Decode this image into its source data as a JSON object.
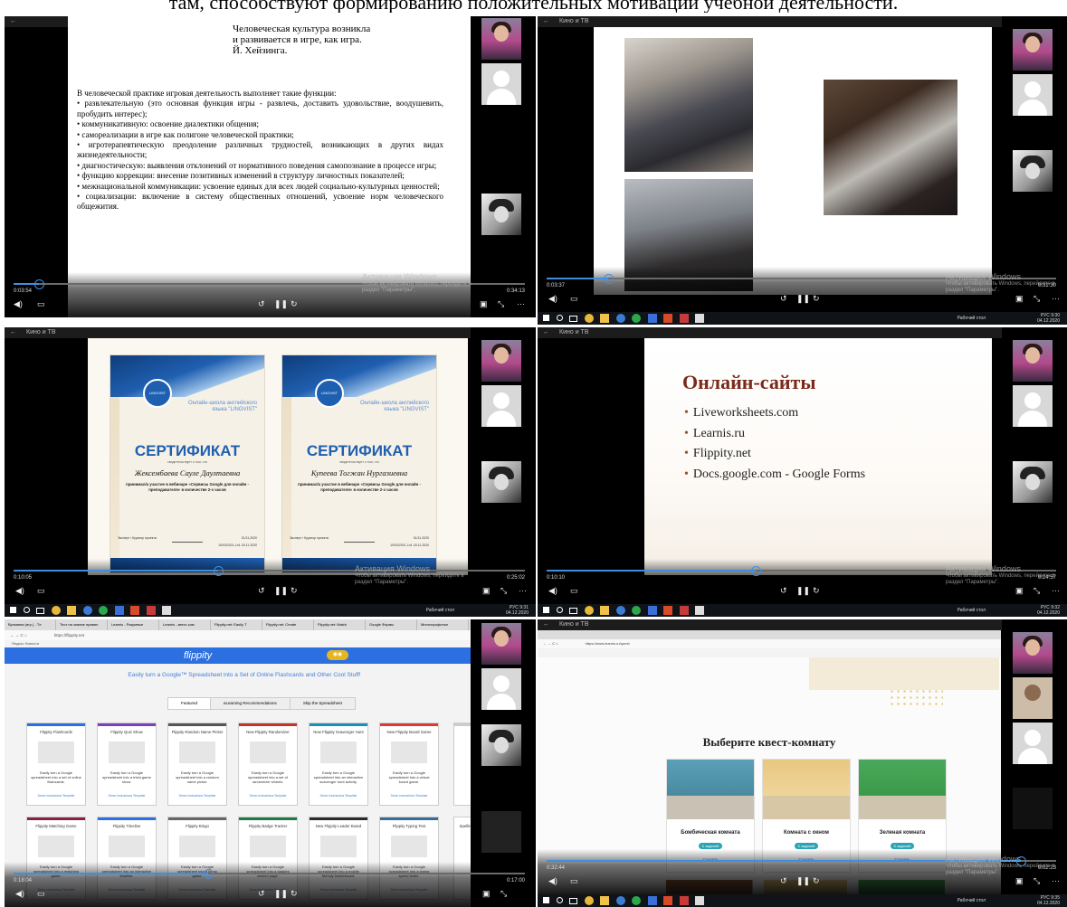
{
  "caption": "там, способствуют формированию положительных мотиваций учебной деятельности.",
  "panel1": {
    "epigraph": [
      "Человеческая культура возникла",
      "и развивается в игре, как игра.",
      "Й. Хейзинга."
    ],
    "paragraphs": [
      "В человеческой практике игровая деятельность выполняет такие функции:",
      "• развлекательную (это основная функция игры - развлечь, доставить удовольствие, воодушевить, пробудить интерес);",
      "• коммуникативную: освоение диалектики общения;",
      "• самореализации в игре как полигоне человеческой практики;",
      "• игротерапевтическую преодоление различных трудностей, возникающих в других видах жизнедеятельности;",
      "• диагностическую: выявления отклонений от нормативного поведения самопознание в процессе игры;",
      "• функцию коррекции: внесение позитивных изменений в структуру личностных показателей;",
      "• межнациональной коммуникации: усвоение единых для всех людей социально-культурных ценностей;",
      "• социализации: включение в систему общественных отношений, усвоение норм человеческого общежития."
    ],
    "time_elapsed": "0:03:54",
    "time_total": "0:34:13",
    "progress": 0.05,
    "watermark_line1": "Активация Windows",
    "watermark_line2": "Чтобы активировать Windows, перейдите в раздел \"Параметры\"."
  },
  "panel2": {
    "window_title": "Кино и ТВ",
    "time_elapsed": "0:03:37",
    "time_total": "0:31:30",
    "progress": 0.12,
    "watermark_line1": "Активация Windows",
    "watermark_line2": "Чтобы активировать Windows, перейдите в раздел \"Параметры\".",
    "taskbar_desktop": "Рабочий стол",
    "taskbar_lang": "РУС",
    "clock_time": "9:30",
    "clock_date": "04.12.2020"
  },
  "panel3": {
    "window_title": "Кино и ТВ",
    "certificates": [
      {
        "school": "Онлайн-школа английского языка \"LINGVIST\"",
        "heading": "СЕРТИФИКАТ",
        "sub": "свидетельствует о том, что",
        "name": "Жексембаева Сауле Даултаевна",
        "text": "принимал/а участие в вебинаре «Сервисы Google для онлайн - преподавателя» в количестве 2-х часов",
        "date": "01/11.2020",
        "footer": "Эксперт / Куратор проекта",
        "reg": "10/03/2021-1л1 18.11.2020"
      },
      {
        "school": "Онлайн-школа английского языка \"LINGVIST\"",
        "heading": "СЕРТИФИКАТ",
        "sub": "свидетельствует о том, что",
        "name": "Купеева Тогжан Нургазиевна",
        "text": "принимал/а участие в вебинаре «Сервисы Google для онлайн - преподавателя» в количестве 2-х часов",
        "date": "01/11.2020",
        "footer": "Эксперт / Куратор проекта",
        "reg": "10/03/2021-1л1 18.11.2020"
      }
    ],
    "time_elapsed": "0:10:05",
    "time_total": "0:25:02",
    "progress": 0.4,
    "watermark_line1": "Активация Windows",
    "watermark_line2": "Чтобы активировать Windows, перейдите в раздел \"Параметры\".",
    "taskbar_desktop": "Рабочий стол",
    "taskbar_lang": "РУС",
    "clock_time": "9:31",
    "clock_date": "04.12.2020"
  },
  "panel4": {
    "window_title": "Кино и ТВ",
    "slide_title": "Онлайн-сайты",
    "slide_items": [
      "Liveworksheets.com",
      "Learnis.ru",
      "Flippity.net",
      "Docs.google.com - Google Forms"
    ],
    "time_elapsed": "0:10:10",
    "time_total": "0:24:57",
    "progress": 0.41,
    "watermark_line1": "Активация Windows",
    "watermark_line2": "Чтобы активировать Windows, перейдите в раздел \"Параметры\".",
    "taskbar_desktop": "Рабочий стол",
    "taskbar_lang": "РУС",
    "clock_time": "9:32",
    "clock_date": "04.12.2020"
  },
  "panel5": {
    "tabs": [
      "Вулкания (игр.) - Тe",
      "Тест на знание правил",
      "Learnis - Разумные",
      "Learnis - квест-ком",
      "Flippity.net: Easily T",
      "Flippity.net: Create",
      "Flippity.net: Match",
      "Google Формы",
      "Многопрофилье",
      "Многопрофилье"
    ],
    "url": "https://flippity.net",
    "bookmarks": "Яндекс   Новости",
    "logo": "flippity",
    "tagline": "Easily turn a Google™ Spreadsheet into a Set of Online Flashcards and Other Cool Stuff!",
    "nav_tabs": [
      "Featured",
      "eLearning Recommendations",
      "Skip the Spreadsheet"
    ],
    "cards_row1": [
      {
        "title": "Flippity Flashcards",
        "desc": "Easily turn a Google spreadsheet into a set of online flashcards.",
        "color": "#2b6fe0"
      },
      {
        "title": "Flippity Quiz Show",
        "desc": "Easily turn a Google spreadsheet into a trivia game show.",
        "color": "#7c3fc0"
      },
      {
        "title": "Flippity Random Name Picker",
        "desc": "Easily turn a Google spreadsheet into a random name picker.",
        "color": "#555555"
      },
      {
        "title": "New Flippity Randomizer",
        "desc": "Easily turn a Google spreadsheet into a set of randomizer wheels.",
        "color": "#c0352b"
      },
      {
        "title": "New Flippity Scavenger Hunt",
        "desc": "Easily turn a Google spreadsheet into an interactive scavenger hunt activity.",
        "color": "#1a8fb0"
      },
      {
        "title": "New Flippity Board Game",
        "desc": "Easily turn a Google spreadsheet into a virtual board game.",
        "color": "#d93a3a"
      }
    ],
    "cards_row2": [
      {
        "title": "Flippity Matching Game",
        "desc": "Easily turn a Google spreadsheet into a matching game.",
        "color": "#8a1f3f"
      },
      {
        "title": "Flippity Timeline",
        "desc": "Easily turn a Google spreadsheet into an interactive timeline.",
        "color": "#2b6fe0"
      },
      {
        "title": "Flippity Bingo",
        "desc": "Easily turn a Google spreadsheet into a bingo game.",
        "color": "#666666"
      },
      {
        "title": "Flippity Badge Tracker",
        "desc": "Easily turn a Google spreadsheet into a badges earned page.",
        "color": "#1f7a3f"
      },
      {
        "title": "New Flippity Leader Board",
        "desc": "Easily turn a Google spreadsheet into a mobile friendly leaderboard.",
        "color": "#2a2a2a"
      },
      {
        "title": "Flippity Typing Test",
        "desc": "Easily turn a Google spreadsheet into a typing speed tester.",
        "color": "#3a6a9a"
      }
    ],
    "card_links": "Demo   Instructions   Template",
    "extra_card": "Spelling Words",
    "time_elapsed": "0:18:04",
    "time_total": "0:17:00",
    "progress": 0.38
  },
  "panel6": {
    "window_title": "Кино и ТВ",
    "url": "https://www.learnis.ru/quest",
    "quest_title": "Выберите квест-комнату",
    "rooms": [
      {
        "name": "Бомбическая комната",
        "badge": "5 заданий",
        "action": "Создать"
      },
      {
        "name": "Комната с окном",
        "badge": "5 заданий",
        "action": "Создать"
      },
      {
        "name": "Зеленая комната",
        "badge": "5 заданий",
        "action": "Создать"
      }
    ],
    "time_elapsed": "0:32:44",
    "time_total": "0:02:23",
    "progress": 0.93,
    "watermark_line1": "Активация Windows",
    "watermark_line2": "Чтобы активировать Windows, перейдите в раздел \"Параметры\".",
    "taskbar_desktop": "Рабочий стол",
    "taskbar_lang": "РУС",
    "clock_time": "9:35",
    "clock_date": "04.12.2020"
  },
  "colors": {
    "progress": "#3f8fe0",
    "flippity_blue": "#2b6fe0",
    "slide_title": "#7a2a1a",
    "quest_badge": "#29a3b5"
  }
}
